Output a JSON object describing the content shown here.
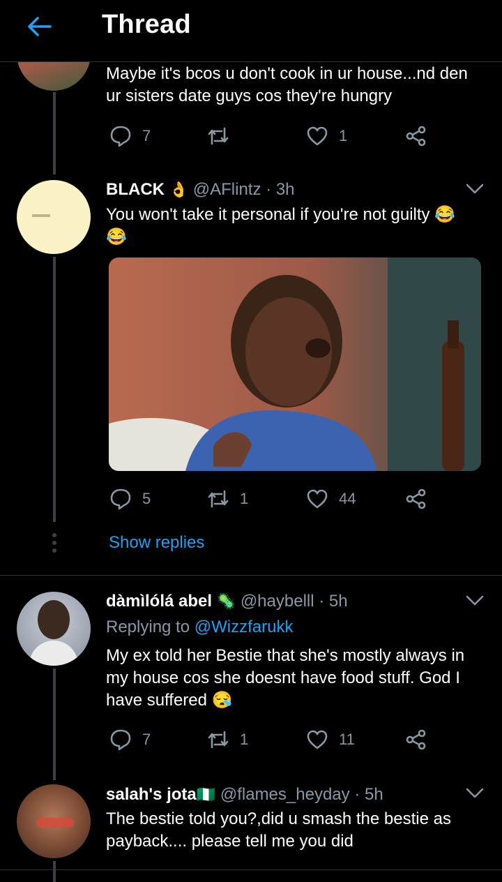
{
  "header": {
    "title": "Thread"
  },
  "tweets": [
    {
      "text_lines": [
        "Maybe it's bcos u don't cook in ur house...nd den",
        "ur sisters date guys cos they're hungry"
      ],
      "replies": "7",
      "retweets": "",
      "likes": "1"
    },
    {
      "name": "BLACK",
      "name_emoji": "👌",
      "handle": "@AFlintz",
      "time": "3h",
      "text_lines": [
        "You won't take it personal if you're not guilty 😂",
        "😂"
      ],
      "replies": "5",
      "retweets": "1",
      "likes": "44",
      "show_replies": "Show replies"
    },
    {
      "name": "dàmìlólá abel",
      "name_emoji": "🦠",
      "handle": "@haybelll",
      "time": "5h",
      "replying_prefix": "Replying to",
      "replying_to": "@Wizzfarukk",
      "text_lines": [
        "My ex told her Bestie that she's mostly always in",
        "my house cos she doesnt have food stuff. God I",
        "have suffered 😪"
      ],
      "replies": "7",
      "retweets": "1",
      "likes": "11"
    },
    {
      "name": "salah's jota",
      "name_emoji": "🇳🇬",
      "handle": "@flames_heyday",
      "time": "5h",
      "text_lines": [
        "The bestie told you?,did u smash the bestie as",
        "payback.... please tell me you did"
      ]
    }
  ],
  "colors": {
    "accent": "#1da1f2",
    "muted": "#8899a6",
    "background": "#000000"
  }
}
